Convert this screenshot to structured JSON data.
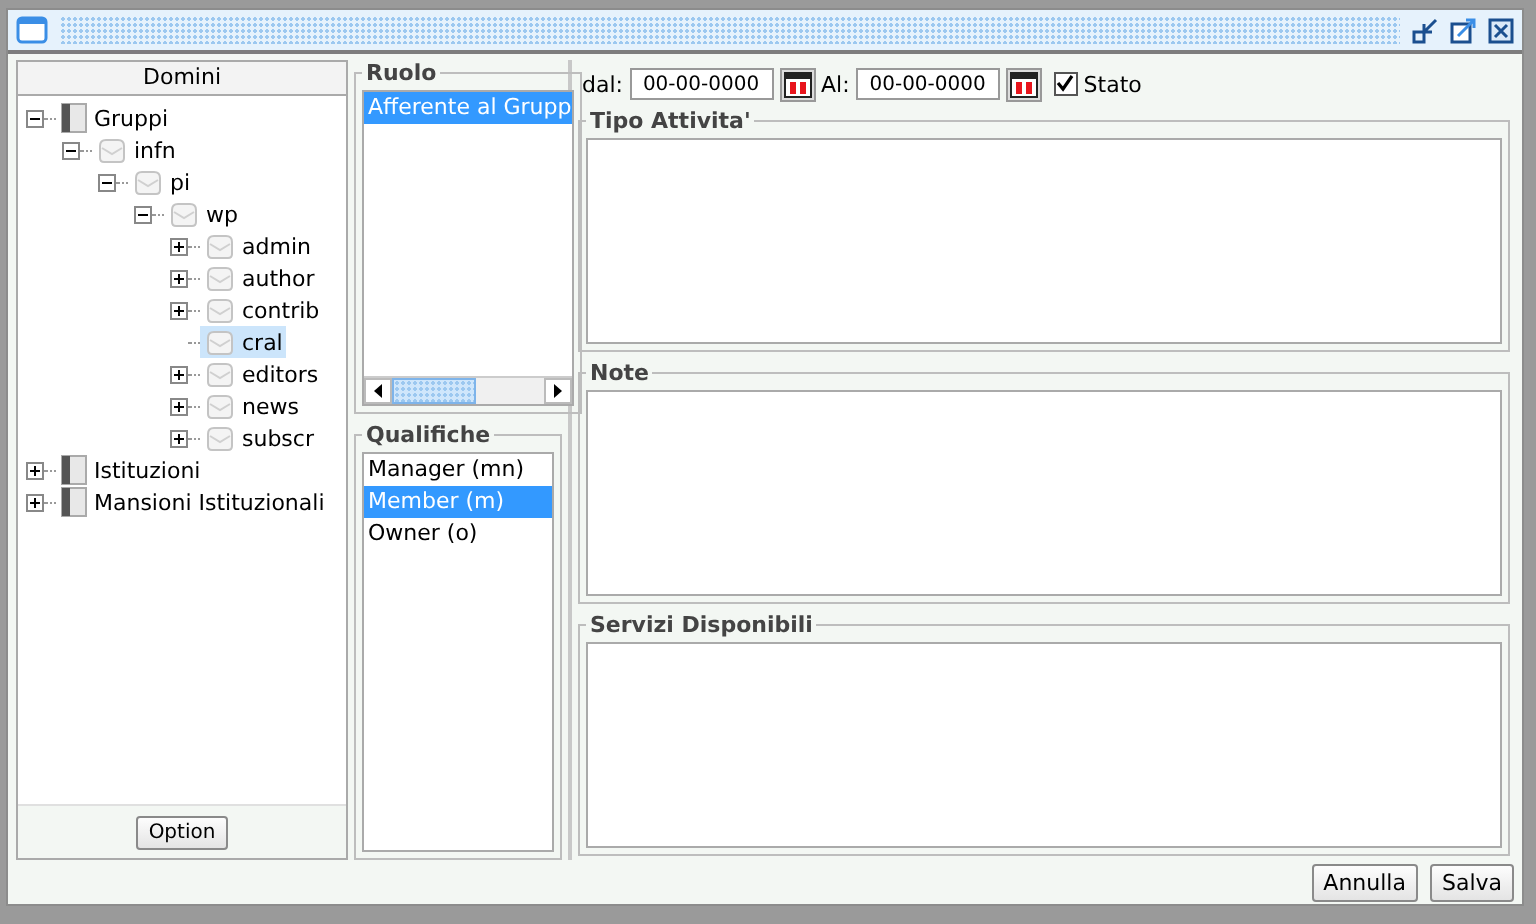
{
  "domains_panel": {
    "header": "Domini",
    "option_button": "Option",
    "tree": [
      {
        "label": "Gruppi",
        "kind": "book",
        "expanded": true,
        "selected": false,
        "children": [
          {
            "label": "infn",
            "kind": "node",
            "expanded": true,
            "selected": false,
            "children": [
              {
                "label": "pi",
                "kind": "node",
                "expanded": true,
                "selected": false,
                "children": [
                  {
                    "label": "wp",
                    "kind": "node",
                    "expanded": true,
                    "selected": false,
                    "children": [
                      {
                        "label": "admin",
                        "kind": "node",
                        "expanded": false,
                        "selected": false
                      },
                      {
                        "label": "author",
                        "kind": "node",
                        "expanded": false,
                        "selected": false
                      },
                      {
                        "label": "contrib",
                        "kind": "node",
                        "expanded": false,
                        "selected": false
                      },
                      {
                        "label": "cral",
                        "kind": "leaf",
                        "selected": true
                      },
                      {
                        "label": "editors",
                        "kind": "node",
                        "expanded": false,
                        "selected": false
                      },
                      {
                        "label": "news",
                        "kind": "node",
                        "expanded": false,
                        "selected": false
                      },
                      {
                        "label": "subscr",
                        "kind": "node",
                        "expanded": false,
                        "selected": false
                      }
                    ]
                  }
                ]
              }
            ]
          }
        ]
      },
      {
        "label": "Istituzioni",
        "kind": "book",
        "expanded": false,
        "selected": false
      },
      {
        "label": "Mansioni Istituzionali",
        "kind": "book",
        "expanded": false,
        "selected": false
      }
    ]
  },
  "role": {
    "title": "Ruolo",
    "items": [
      {
        "label": "Afferente al Grupp",
        "selected": true
      }
    ]
  },
  "qualifications": {
    "title": "Qualifiche",
    "items": [
      {
        "label": "Manager (mn)",
        "selected": false
      },
      {
        "label": "Member (m)",
        "selected": true
      },
      {
        "label": "Owner (o)",
        "selected": false
      }
    ]
  },
  "filters": {
    "from_label": "dal:",
    "from_value": "00-00-0000",
    "to_label": "Al:",
    "to_value": "00-00-0000",
    "status": {
      "label": "Stato",
      "checked": true
    }
  },
  "groups": [
    {
      "title": "Tipo Attivita'"
    },
    {
      "title": "Note"
    },
    {
      "title": "Servizi Disponibili"
    }
  ],
  "buttons": [
    "Annulla",
    "Salva"
  ]
}
